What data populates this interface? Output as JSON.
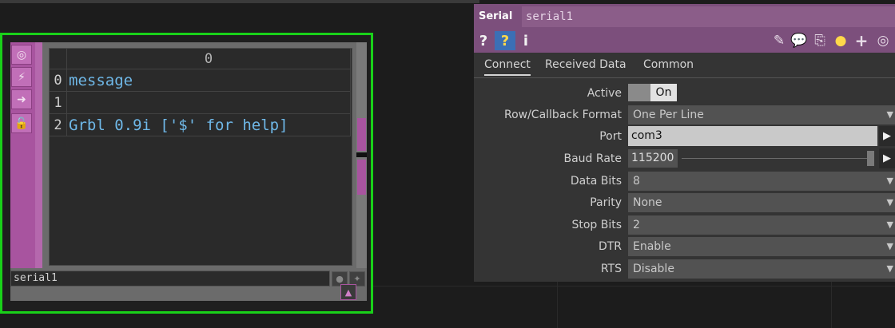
{
  "node": {
    "viewer": {
      "column_header": "0",
      "rows": [
        {
          "index": "0",
          "value": "message"
        },
        {
          "index": "1",
          "value": ""
        },
        {
          "index": "2",
          "value": "Grbl 0.9i ['$' for help]"
        }
      ]
    },
    "name": "serial1",
    "strip_icons": [
      "target-icon",
      "bypass-icon",
      "arrow-right-icon",
      "lock-icon"
    ]
  },
  "panel": {
    "op_type": "Serial",
    "op_name": "serial1",
    "tools_left": [
      "?",
      "?",
      "i"
    ],
    "tools_right": [
      "pencil-icon",
      "comment-icon",
      "clone-icon",
      "python-icon",
      "plus-icon",
      "target-icon"
    ],
    "tabs": [
      "Connect",
      "Received Data",
      "Common"
    ],
    "active_tab": "Connect",
    "params": {
      "active": {
        "label": "Active",
        "value": "On"
      },
      "format": {
        "label": "Row/Callback Format",
        "value": "One Per Line"
      },
      "port": {
        "label": "Port",
        "value": "com3"
      },
      "baud": {
        "label": "Baud Rate",
        "value": "115200"
      },
      "databits": {
        "label": "Data Bits",
        "value": "8"
      },
      "parity": {
        "label": "Parity",
        "value": "None"
      },
      "stopbits": {
        "label": "Stop Bits",
        "value": "2"
      },
      "dtr": {
        "label": "DTR",
        "value": "Enable"
      },
      "rts": {
        "label": "RTS",
        "value": "Disable"
      }
    }
  },
  "colors": {
    "node_border": "#19d119",
    "accent": "#a8549f",
    "panel_header": "#7c4f7c",
    "viewer_text": "#6fb8e8"
  }
}
